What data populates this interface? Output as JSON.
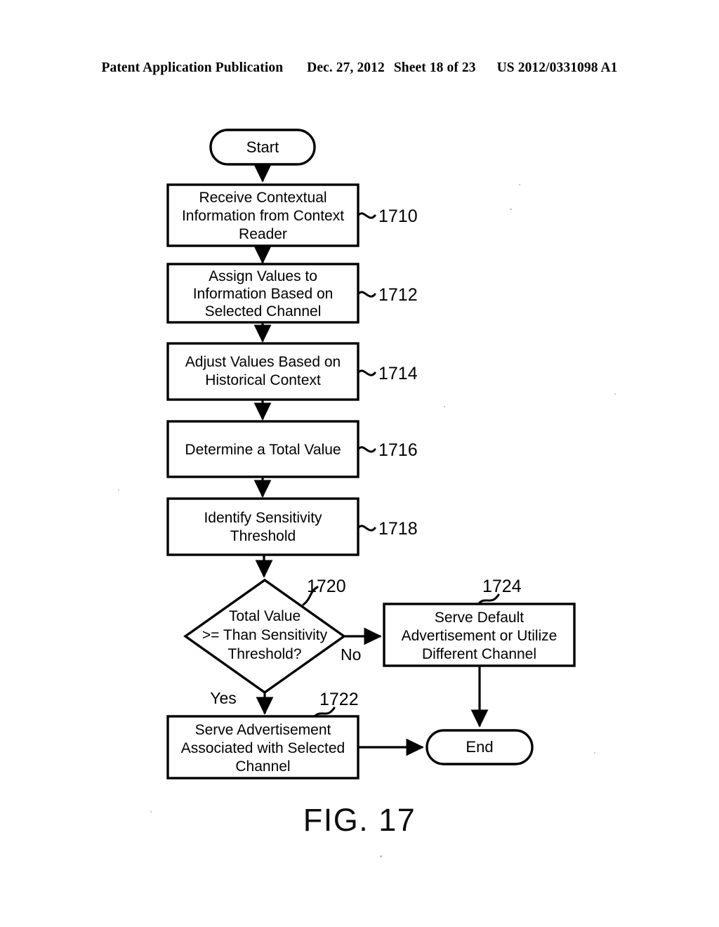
{
  "header": {
    "publication": "Patent Application Publication",
    "date": "Dec. 27, 2012",
    "sheet": "Sheet 18 of 23",
    "patent_number": "US 2012/0331098 A1"
  },
  "figure": {
    "caption": "FIG. 17"
  },
  "flowchart": {
    "start_label": "Start",
    "end_label": "End",
    "steps": [
      {
        "id": "1710",
        "ref": "1710",
        "lines": [
          "Receive Contextual",
          "Information from Context",
          "Reader"
        ]
      },
      {
        "id": "1712",
        "ref": "1712",
        "lines": [
          "Assign Values to",
          "Information Based on",
          "Selected Channel"
        ]
      },
      {
        "id": "1714",
        "ref": "1714",
        "lines": [
          "Adjust Values Based on",
          "Historical Context"
        ]
      },
      {
        "id": "1716",
        "ref": "1716",
        "lines": [
          "Determine a Total Value"
        ]
      },
      {
        "id": "1718",
        "ref": "1718",
        "lines": [
          "Identify Sensitivity",
          "Threshold"
        ]
      }
    ],
    "decision": {
      "ref": "1720",
      "lines": [
        "Total Value",
        ">= Than Sensitivity",
        "Threshold?"
      ],
      "yes_label": "Yes",
      "no_label": "No"
    },
    "yes_branch": {
      "ref": "1722",
      "lines": [
        "Serve Advertisement",
        "Associated with Selected",
        "Channel"
      ]
    },
    "no_branch": {
      "ref": "1724",
      "lines": [
        "Serve Default",
        "Advertisement or Utilize",
        "Different Channel"
      ]
    }
  },
  "colors": {
    "ink": "#000000",
    "paper": "#ffffff"
  }
}
